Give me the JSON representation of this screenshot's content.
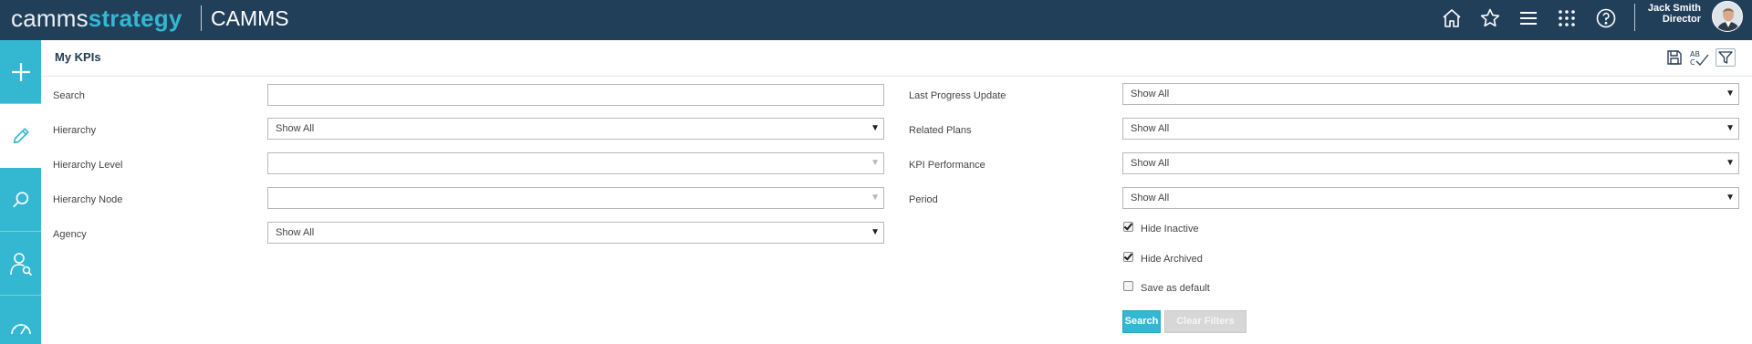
{
  "topbar": {
    "logo_part1": "camms",
    "logo_part2": "strategy",
    "app_name": "CAMMS",
    "user_name": "Jack Smith",
    "user_role": "Director"
  },
  "sidebar": {
    "items": [
      {
        "name": "add",
        "icon": "plus-icon"
      },
      {
        "name": "edit",
        "icon": "pencil-icon"
      },
      {
        "name": "search",
        "icon": "search-icon"
      },
      {
        "name": "people",
        "icon": "user-search-icon"
      },
      {
        "name": "dashboard",
        "icon": "gauge-icon"
      }
    ]
  },
  "page": {
    "title": "My KPIs"
  },
  "filters": {
    "search_label": "Search",
    "search_value": "",
    "hierarchy_label": "Hierarchy",
    "hierarchy_value": "Show All",
    "hierarchy_level_label": "Hierarchy Level",
    "hierarchy_level_value": "",
    "hierarchy_node_label": "Hierarchy Node",
    "hierarchy_node_value": "",
    "agency_label": "Agency",
    "agency_value": "Show All",
    "last_progress_label": "Last Progress Update",
    "last_progress_value": "Show All",
    "related_plans_label": "Related Plans",
    "related_plans_value": "Show All",
    "kpi_performance_label": "KPI Performance",
    "kpi_performance_value": "Show All",
    "period_label": "Period",
    "period_value": "Show All",
    "hide_inactive_label": "Hide Inactive",
    "hide_inactive_checked": true,
    "hide_archived_label": "Hide Archived",
    "hide_archived_checked": true,
    "save_default_label": "Save as default",
    "save_default_checked": false
  },
  "actions": {
    "search_label": "Search",
    "clear_label": "Clear Filters"
  },
  "colors": {
    "topbar": "#223f5a",
    "accent": "#34b7d1"
  }
}
